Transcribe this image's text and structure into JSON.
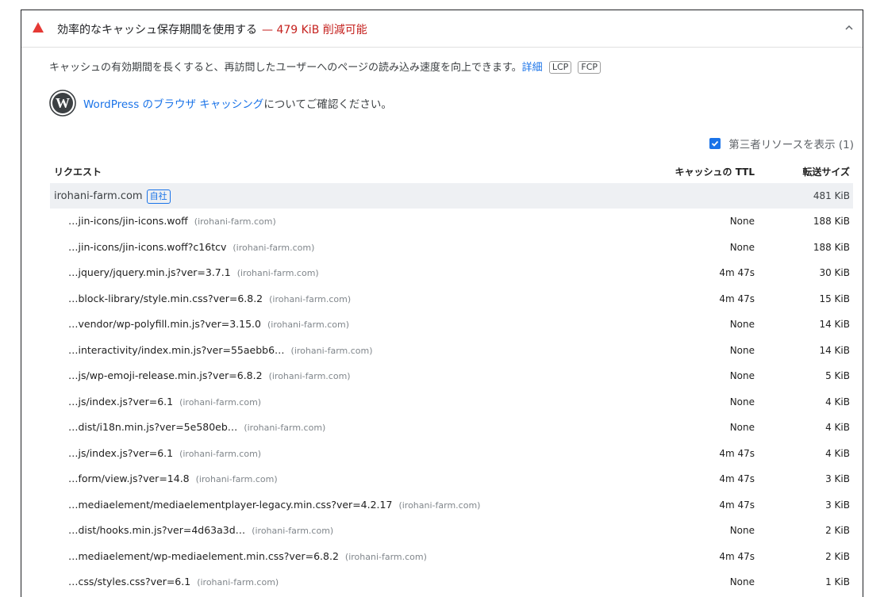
{
  "audit": {
    "title": "効率的なキャッシュ保存期間を使用する",
    "savings": "— 479 KiB 削減可能",
    "description": "キャッシュの有効期間を長くすると、再訪問したユーザーへのページの読み込み速度を向上できます。",
    "learn_more": "詳細",
    "tags": [
      "LCP",
      "FCP"
    ],
    "colors": {
      "warning": "#e53935",
      "link": "#1a73e8",
      "savings": "#c5221f"
    }
  },
  "wordpress": {
    "link_text": "WordPress のブラウザ キャッシング",
    "suffix": "についてご確認ください。"
  },
  "third_party": {
    "label": "第三者リソースを表示 (1)",
    "checked": true
  },
  "table": {
    "headers": [
      "リクエスト",
      "キャッシュの TTL",
      "転送サイズ"
    ],
    "group": {
      "url": "irohani-farm.com",
      "badge": "自社",
      "size": "481 KiB"
    },
    "rows": [
      {
        "url": "…jin-icons/jin-icons.woff",
        "host": "(irohani-farm.com)",
        "ttl": "None",
        "size": "188 KiB"
      },
      {
        "url": "…jin-icons/jin-icons.woff?c16tcv",
        "host": "(irohani-farm.com)",
        "ttl": "None",
        "size": "188 KiB"
      },
      {
        "url": "…jquery/jquery.min.js?ver=3.7.1",
        "host": "(irohani-farm.com)",
        "ttl": "4m 47s",
        "size": "30 KiB"
      },
      {
        "url": "…block-library/style.min.css?ver=6.8.2",
        "host": "(irohani-farm.com)",
        "ttl": "4m 47s",
        "size": "15 KiB"
      },
      {
        "url": "…vendor/wp-polyfill.min.js?ver=3.15.0",
        "host": "(irohani-farm.com)",
        "ttl": "None",
        "size": "14 KiB"
      },
      {
        "url": "…interactivity/index.min.js?ver=55aebb6…",
        "host": "(irohani-farm.com)",
        "ttl": "None",
        "size": "14 KiB"
      },
      {
        "url": "…js/wp-emoji-release.min.js?ver=6.8.2",
        "host": "(irohani-farm.com)",
        "ttl": "None",
        "size": "5 KiB"
      },
      {
        "url": "…js/index.js?ver=6.1",
        "host": "(irohani-farm.com)",
        "ttl": "None",
        "size": "4 KiB"
      },
      {
        "url": "…dist/i18n.min.js?ver=5e580eb…",
        "host": "(irohani-farm.com)",
        "ttl": "None",
        "size": "4 KiB"
      },
      {
        "url": "…js/index.js?ver=6.1",
        "host": "(irohani-farm.com)",
        "ttl": "4m 47s",
        "size": "4 KiB"
      },
      {
        "url": "…form/view.js?ver=14.8",
        "host": "(irohani-farm.com)",
        "ttl": "4m 47s",
        "size": "3 KiB"
      },
      {
        "url": "…mediaelement/mediaelementplayer-legacy.min.css?ver=4.2.17",
        "host": "(irohani-farm.com)",
        "ttl": "4m 47s",
        "size": "3 KiB"
      },
      {
        "url": "…dist/hooks.min.js?ver=4d63a3d…",
        "host": "(irohani-farm.com)",
        "ttl": "None",
        "size": "2 KiB"
      },
      {
        "url": "…mediaelement/wp-mediaelement.min.css?ver=6.8.2",
        "host": "(irohani-farm.com)",
        "ttl": "4m 47s",
        "size": "2 KiB"
      },
      {
        "url": "…css/styles.css?ver=6.1",
        "host": "(irohani-farm.com)",
        "ttl": "None",
        "size": "1 KiB"
      }
    ]
  }
}
